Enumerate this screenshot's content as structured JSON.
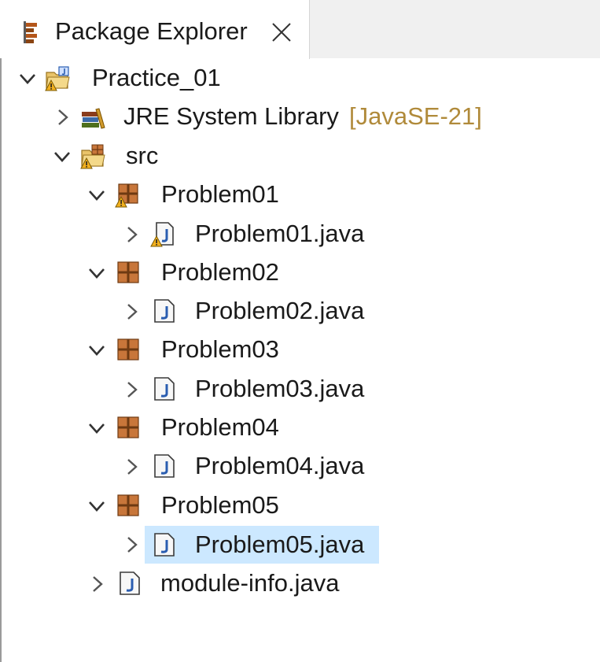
{
  "view": {
    "title": "Package Explorer",
    "icon": "package-explorer-icon",
    "close_icon": "close-icon"
  },
  "tree": {
    "project": {
      "label": "Practice_01",
      "icon": "java-project-warning-icon",
      "expanded": true
    },
    "jre": {
      "label": "JRE System Library",
      "decoration": "[JavaSE-21]",
      "icon": "library-icon",
      "expanded": false
    },
    "src": {
      "label": "src",
      "icon": "source-folder-warning-icon",
      "expanded": true
    },
    "packages": [
      {
        "label": "Problem01",
        "icon": "package-warning-icon",
        "file": {
          "label": "Problem01.java",
          "icon": "java-file-warning-icon",
          "selected": false
        }
      },
      {
        "label": "Problem02",
        "icon": "package-icon",
        "file": {
          "label": "Problem02.java",
          "icon": "java-file-icon",
          "selected": false
        }
      },
      {
        "label": "Problem03",
        "icon": "package-icon",
        "file": {
          "label": "Problem03.java",
          "icon": "java-file-icon",
          "selected": false
        }
      },
      {
        "label": "Problem04",
        "icon": "package-icon",
        "file": {
          "label": "Problem04.java",
          "icon": "java-file-icon",
          "selected": false
        }
      },
      {
        "label": "Problem05",
        "icon": "package-icon",
        "file": {
          "label": "Problem05.java",
          "icon": "java-file-icon",
          "selected": true
        }
      }
    ],
    "module_info": {
      "label": "module-info.java",
      "icon": "java-file-icon",
      "expanded": false
    }
  },
  "colors": {
    "selection": "#cce8ff",
    "decoration": "#b08a3a",
    "package": "#8b4513",
    "java_file": "#2a5db0",
    "warning": "#f2b01e"
  }
}
